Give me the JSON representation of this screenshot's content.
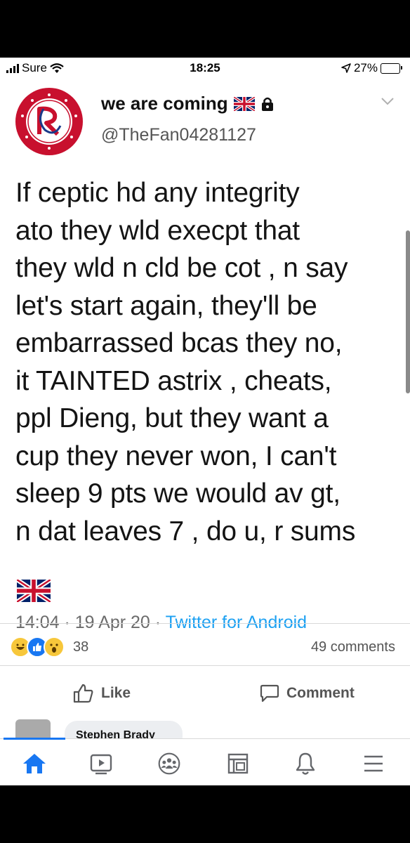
{
  "status_bar": {
    "carrier": "Sure",
    "time": "18:25",
    "battery": "27%",
    "battery_level": 0.27
  },
  "tweet": {
    "display_name": "we are coming",
    "handle": "@TheFan04281127",
    "text": "If ceptic hd any integrity\nato they wld execpt that\nthey wld n cld be cot , n say\nlet's start again, they'll be\nembarrassed bcas they no,\nit TAINTED astrix , cheats,\nppl Dieng, but they want a\ncup they never won, I can't\nsleep 9 pts we would av gt,\nn dat leaves 7 , do u, r sums",
    "timestamp": "14:04 · 19 Apr 20 · ",
    "source": "Twitter for Android"
  },
  "post": {
    "reaction_icons": [
      "laugh-reaction-icon",
      "like-reaction-icon",
      "wow-reaction-icon"
    ],
    "reaction_count": "38",
    "comment_count": "49 comments",
    "like_label": "Like",
    "comment_label": "Comment",
    "comment_preview_name": "Stephen Brady"
  },
  "tabbar": {
    "items": [
      "home-icon",
      "watch-icon",
      "groups-icon",
      "pages-icon",
      "notifications-icon",
      "menu-icon"
    ],
    "active": "home-icon"
  },
  "colors": {
    "accent": "#1877f2",
    "twitter_blue": "#1da1f2",
    "avatar_red": "#c8102e"
  }
}
